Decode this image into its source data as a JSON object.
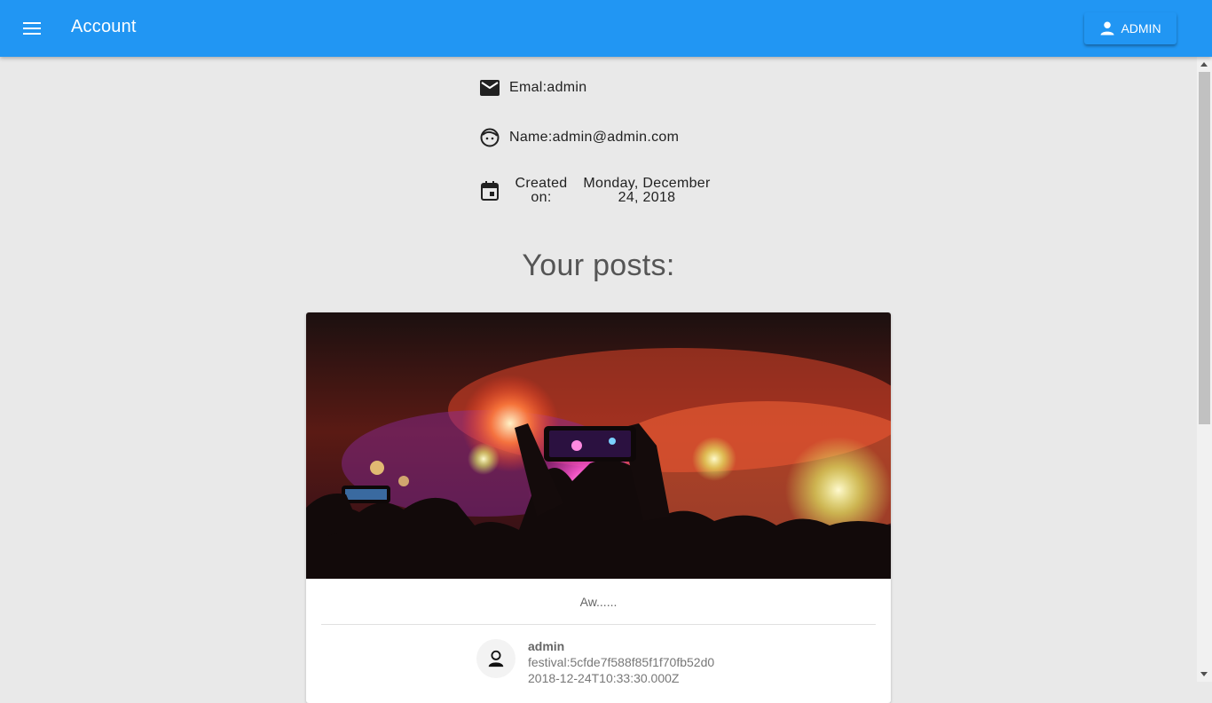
{
  "header": {
    "title": "Account",
    "user_button_label": "ADMIN",
    "color": "#2196f3"
  },
  "profile": {
    "email_text": "Emal:admin",
    "name_text": "Name:admin@admin.com",
    "created_label": "Created on:",
    "created_value": "Monday, December 24, 2018"
  },
  "posts": {
    "heading": "Your posts:",
    "items": [
      {
        "caption": "Aw......",
        "author": "admin",
        "tag": "festival:5cfde7f588f85f1f70fb52d0",
        "date": "2018-12-24T10:33:30.000Z"
      }
    ]
  },
  "icons": {
    "menu": "hamburger-icon",
    "user": "person-icon",
    "email": "mail-icon",
    "name": "face-icon",
    "created": "calendar-icon"
  }
}
